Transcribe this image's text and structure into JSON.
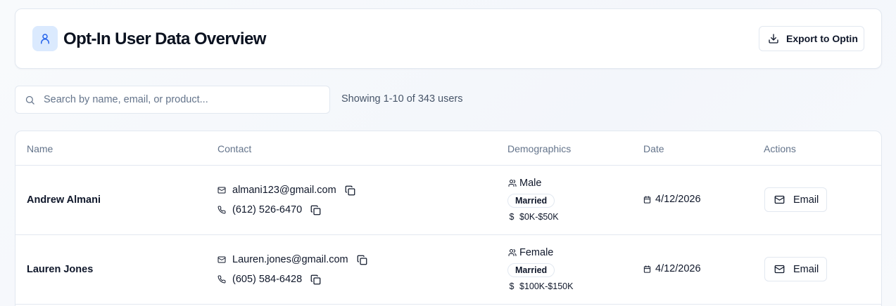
{
  "header": {
    "title": "Opt-In User Data Overview",
    "export_label": "Export to Optin"
  },
  "search": {
    "placeholder": "Search by name, email, or product...",
    "value": ""
  },
  "showing": "Showing 1-10 of 343 users",
  "table": {
    "columns": [
      "Name",
      "Contact",
      "Demographics",
      "Date",
      "Actions"
    ],
    "rows": [
      {
        "name": "Andrew Almani",
        "email": "almani123@gmail.com",
        "phone": "(612) 526-6470",
        "gender": "Male",
        "marital": "Married",
        "income": "$0K-$50K",
        "date": "4/12/2026",
        "action": "Email"
      },
      {
        "name": "Lauren Jones",
        "email": "Lauren.jones@gmail.com",
        "phone": "(605) 584-6428",
        "gender": "Female",
        "marital": "Married",
        "income": "$100K-$150K",
        "date": "4/12/2026",
        "action": "Email"
      }
    ]
  },
  "icons": {
    "header": "user-icon",
    "export": "download-icon",
    "search": "search-icon",
    "email": "mail-icon",
    "phone": "phone-icon",
    "copy": "copy-icon",
    "gender": "users-icon",
    "income": "dollar-icon",
    "date": "calendar-icon"
  },
  "colors": {
    "accent": "#2563eb",
    "accent_bg": "#dbeafe",
    "border": "#e2e8f0",
    "muted": "#64748b"
  }
}
